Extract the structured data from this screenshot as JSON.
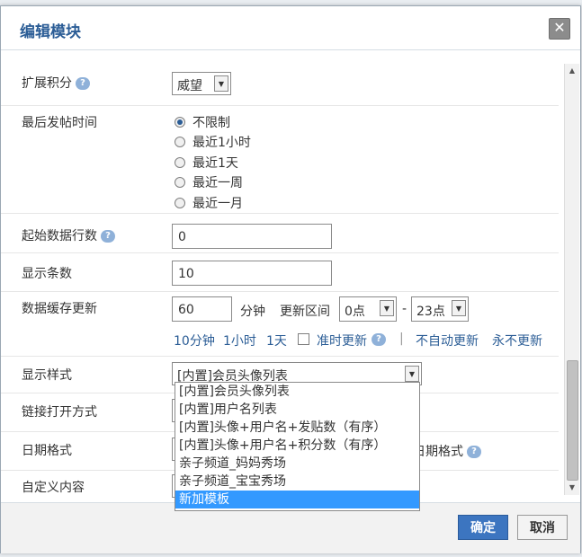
{
  "dialog": {
    "title": "编辑模块"
  },
  "fields": {
    "ext_credit": {
      "label": "扩展积分",
      "value": "威望"
    },
    "last_post_time": {
      "label": "最后发帖时间",
      "options": [
        "不限制",
        "最近1小时",
        "最近1天",
        "最近一周",
        "最近一月"
      ],
      "selected": "不限制"
    },
    "start_row": {
      "label": "起始数据行数",
      "value": "0"
    },
    "show_count": {
      "label": "显示条数",
      "value": "10"
    },
    "cache": {
      "label": "数据缓存更新",
      "minutes": "60",
      "minutes_unit": "分钟",
      "interval_label": "更新区间",
      "from": "0点",
      "dash": "-",
      "to": "23点",
      "quick": [
        "10分钟",
        "1小时",
        "1天"
      ],
      "ontime": "准时更新",
      "sep": "|",
      "no_auto": "不自动更新",
      "never": "永不更新"
    },
    "display_style": {
      "label": "显示样式",
      "value": "[内置]会员头像列表",
      "options": [
        "[内置]会员头像列表",
        "[内置]用户名列表",
        "[内置]头像+用户名+发贴数（有序）",
        "[内置]头像+用户名+积分数（有序）",
        "亲子频道_妈妈秀场",
        "亲子频道_宝宝秀场",
        "新加模板"
      ],
      "highlighted": "新加模板"
    },
    "link_open": {
      "label": "链接打开方式"
    },
    "date_format": {
      "label": "日期格式",
      "partial_text": "日期格式"
    },
    "custom_content": {
      "label": "自定义内容"
    }
  },
  "footer": {
    "ok": "确定",
    "cancel": "取消"
  },
  "icons": {
    "close": "close-icon",
    "help": "help-icon",
    "dropdown": "dropdown-arrow-icon"
  }
}
